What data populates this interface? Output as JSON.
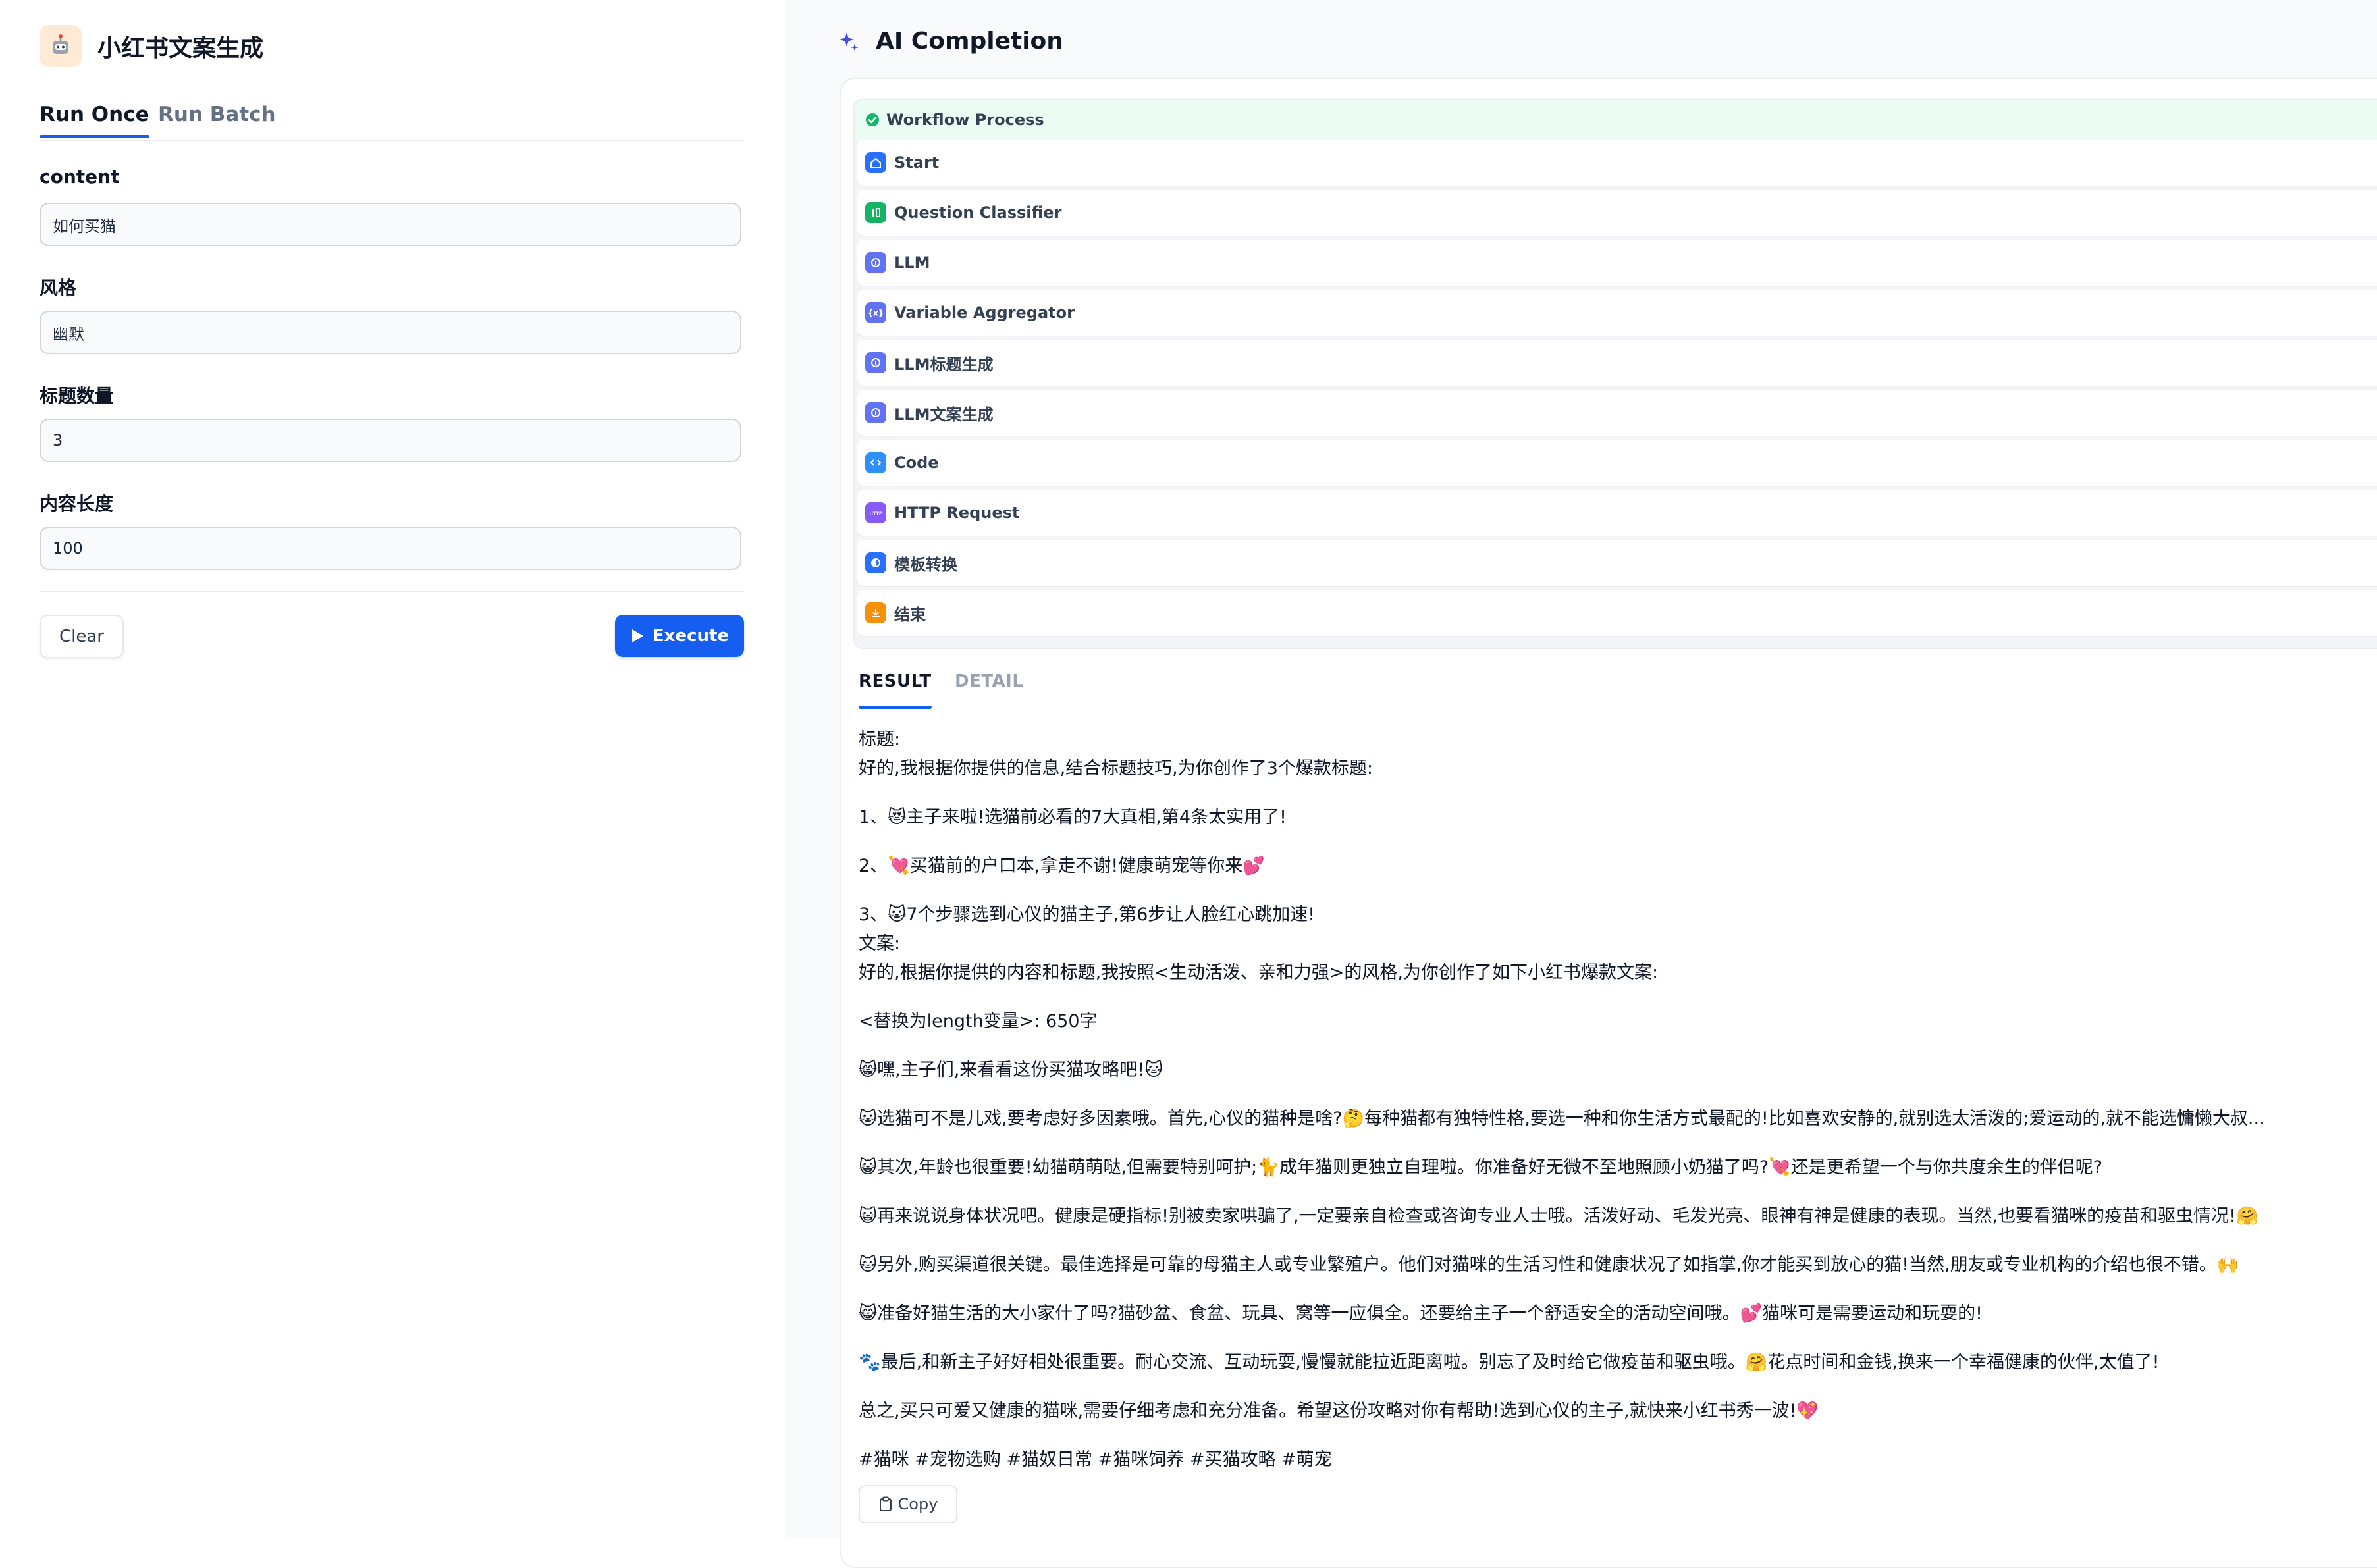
{
  "app": {
    "title": "小红书文案生成",
    "tabs": [
      "Run Once",
      "Run Batch"
    ]
  },
  "form": {
    "fields": [
      {
        "label": "content",
        "value": "如何买猫"
      },
      {
        "label": "风格",
        "value": "幽默"
      },
      {
        "label": "标题数量",
        "value": "3"
      },
      {
        "label": "内容长度",
        "value": "100"
      }
    ],
    "clear_label": "Clear",
    "execute_label": "Execute"
  },
  "completion": {
    "title": "AI Completion",
    "workflow_label": "Workflow Process",
    "nodes": [
      {
        "label": "Start",
        "icon": "home-icon",
        "color": "#2970ff"
      },
      {
        "label": "Question Classifier",
        "icon": "classifier-icon",
        "color": "#16b364"
      },
      {
        "label": "LLM",
        "icon": "llm-icon",
        "color": "#6172f3"
      },
      {
        "label": "Variable Aggregator",
        "icon": "variable-icon",
        "color": "#6172f3"
      },
      {
        "label": "LLM标题生成",
        "icon": "llm-icon",
        "color": "#6172f3"
      },
      {
        "label": "LLM文案生成",
        "icon": "llm-icon",
        "color": "#6172f3"
      },
      {
        "label": "Code",
        "icon": "code-icon",
        "color": "#2e90fa"
      },
      {
        "label": "HTTP Request",
        "icon": "http-icon",
        "color": "#875bf7"
      },
      {
        "label": "模板转换",
        "icon": "template-icon",
        "color": "#2970ff"
      },
      {
        "label": "结束",
        "icon": "end-icon",
        "color": "#f79009"
      }
    ],
    "result_tabs": [
      "RESULT",
      "DETAIL"
    ],
    "result_lines": [
      "标题:",
      "好的,我根据你提供的信息,结合标题技巧,为你创作了3个爆款标题:",
      "",
      "1、😻主子来啦!选猫前必看的7大真相,第4条太实用了!",
      "",
      "2、💘买猫前的户口本,拿走不谢!健康萌宠等你来💕",
      "",
      "3、🐱7个步骤选到心仪的猫主子,第6步让人脸红心跳加速!",
      "文案:",
      "好的,根据你提供的内容和标题,我按照<生动活泼、亲和力强>的风格,为你创作了如下小红书爆款文案:",
      "",
      "<替换为length变量>: 650字",
      "",
      "😸嘿,主子们,来看看这份买猫攻略吧!🐱",
      "",
      "🐱选猫可不是儿戏,要考虑好多因素哦。首先,心仪的猫种是啥?🤔每种猫都有独特性格,要选一种和你生活方式最配的!比如喜欢安静的,就别选太活泼的;爱运动的,就不能选慵懒大叔...",
      "",
      "😺其次,年龄也很重要!幼猫萌萌哒,但需要特别呵护;🐈成年猫则更独立自理啦。你准备好无微不至地照顾小奶猫了吗?💘还是更希望一个与你共度余生的伴侣呢?",
      "",
      "😺再来说说身体状况吧。健康是硬指标!别被卖家哄骗了,一定要亲自检查或咨询专业人士哦。活泼好动、毛发光亮、眼神有神是健康的表现。当然,也要看猫咪的疫苗和驱虫情况!🤗",
      "",
      "🐱另外,购买渠道很关键。最佳选择是可靠的母猫主人或专业繁殖户。他们对猫咪的生活习性和健康状况了如指掌,你才能买到放心的猫!当然,朋友或专业机构的介绍也很不错。🙌",
      "",
      "😸准备好猫生活的大小家什了吗?猫砂盆、食盆、玩具、窝等一应俱全。还要给主子一个舒适安全的活动空间哦。💕猫咪可是需要运动和玩耍的!",
      "",
      "🐾最后,和新主子好好相处很重要。耐心交流、互动玩耍,慢慢就能拉近距离啦。别忘了及时给它做疫苗和驱虫哦。🤗花点时间和金钱,换来一个幸福健康的伙伴,太值了!",
      "",
      "总之,买只可爱又健康的猫咪,需要仔细考虑和充分准备。希望这份攻略对你有帮助!选到心仪的主子,就快来小红书秀一波!💖",
      "",
      "#猫咪 #宠物选购 #猫奴日常 #猫咪饲养 #买猫攻略 #萌宠"
    ],
    "copy_label": "Copy"
  },
  "colors": {
    "accent": "#155eef",
    "success": "#12b76a",
    "sparkle": "#444ce7"
  }
}
